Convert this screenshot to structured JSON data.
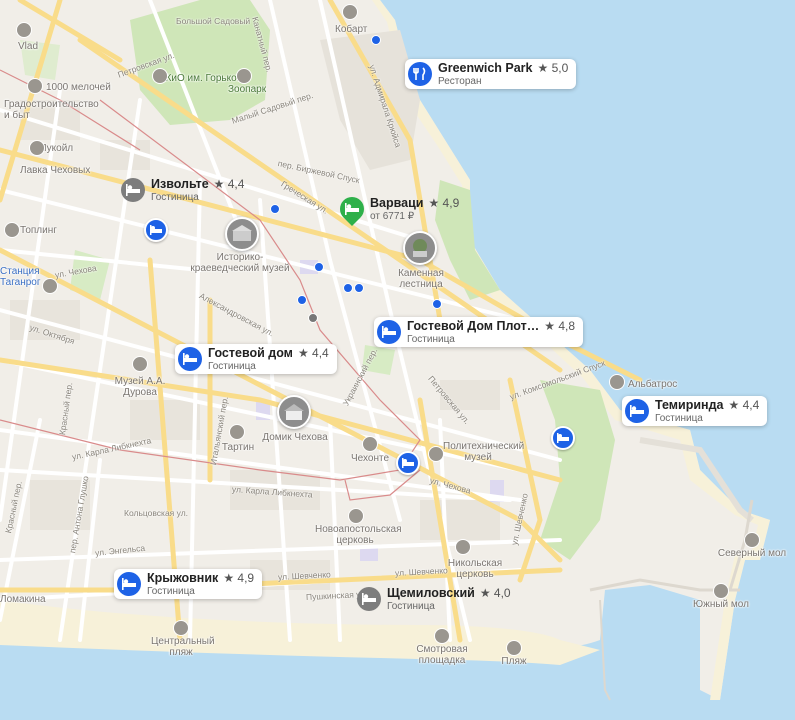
{
  "pois": [
    {
      "name": "Greenwich Park",
      "rating": "★ 5,0",
      "sub": "Ресторан",
      "kind": "restaurant"
    },
    {
      "name": "Извольте",
      "rating": "★ 4,4",
      "sub": "Гостиница",
      "kind": "hotel"
    },
    {
      "name": "Варваци",
      "rating": "★ 4,9",
      "sub": "от 6771 ₽",
      "kind": "hotel"
    },
    {
      "name": "Гостевой Дом Плот…",
      "rating": "★ 4,8",
      "sub": "Гостиница",
      "kind": "hotel"
    },
    {
      "name": "Гостевой дом",
      "rating": "★ 4,4",
      "sub": "Гостиница",
      "kind": "hotel"
    },
    {
      "name": "Темиринда",
      "rating": "★ 4,4",
      "sub": "Гостиница",
      "kind": "hotel"
    },
    {
      "name": "Крыжовник",
      "rating": "★ 4,9",
      "sub": "Гостиница",
      "kind": "hotel"
    },
    {
      "name": "Щемиловский",
      "rating": "★ 4,0",
      "sub": "Гостиница",
      "kind": "hotel"
    }
  ],
  "places": {
    "park": "ПКиО им. Горького",
    "zoo": "Зоопарк",
    "kobart": "Кобарт",
    "vlad": "Vlad",
    "shop1000": "1000 мелочей",
    "gradostroitelstvo": "Градостроительство и быт",
    "lukoil": "Лукойл",
    "lavka": "Лавка Чеховых",
    "topling": "Топлинг",
    "station": "Станция Таганрог",
    "museum_history": "Историко-краеведческий музей",
    "stairs": "Каменная лестница",
    "museum_durov": "Музей А.А. Дурова",
    "domik": "Домик Чехова",
    "tartin": "Тартин",
    "chehonte": "Чехонте",
    "politech": "Политехнический музей",
    "albatros": "Альбатрос",
    "church_novo": "Новоапостольская церковь",
    "church_nik": "Никольская церковь",
    "north_pier": "Северный мол",
    "south_pier": "Южный мол",
    "central_beach": "Центральный пляж",
    "observ": "Смотровая площадка",
    "beach": "Пляж",
    "lomakina": "Ломакина"
  },
  "streets": {
    "bolshaya_sad": "Большой Садовый",
    "kanatnyi": "Канатный пер.",
    "petrovskaya1": "Петровская ул.",
    "petrovskaya2": "Петровская ул.",
    "maly_sad": "Малый Садовый пер.",
    "admirala": "ул. Адмирала Крюйса",
    "birzhevoy": "пер. Биржевой Спуск",
    "grecheskaya": "Греческая ул.",
    "chekhova": "ул. Чехова",
    "chekhova2": "ул. Чехова",
    "oktyabrskaya": "ул. Октября",
    "aleksandrovskaya": "Александровская ул.",
    "ukrainsky": "Украинский пер.",
    "italyansky": "Итальянский пер.",
    "krasny": "Красный пер.",
    "karla1": "ул. Карла Либкнехта",
    "karla2": "ул. Карла Либкнехта",
    "pushkina": "пер. Антона Глушко",
    "koltsovskaya": "Кольцовская ул.",
    "engelsa": "ул. Энгельса",
    "shevchenko": "ул. Шевченко",
    "shevchenko2": "ул. Шевченко",
    "shevchenko3": "ул. Шевченко",
    "pushkinskaya": "Пушкинская ул.",
    "komsomolsky": "ул. Комсомольский Спуск",
    "krasnyi2": "Красный пер.",
    "chekhova_w": "ул. Чехова"
  },
  "colors": {
    "sea": "#b9dcf2",
    "land": "#f1eee8",
    "park": "#cfe6b8",
    "road": "#ffffff",
    "major_road": "#fbe3a0",
    "hotel_pin": "#1e62e6",
    "green_pin": "#2eb04a",
    "rail": "#d98b8b"
  }
}
